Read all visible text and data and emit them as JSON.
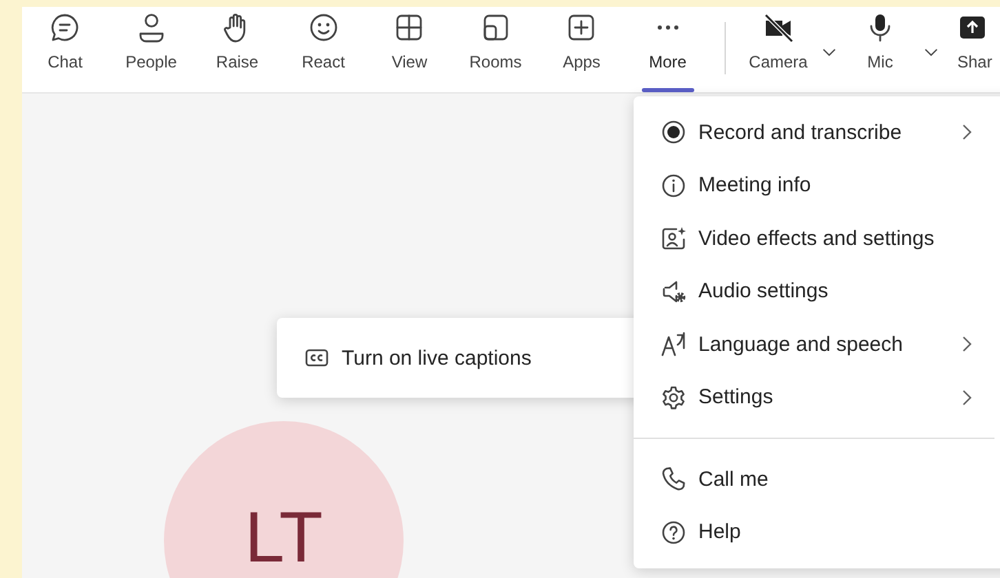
{
  "toolbar": {
    "buttons": [
      {
        "label": "Chat",
        "kind": "button",
        "selected": false
      },
      {
        "label": "People",
        "kind": "button",
        "selected": false
      },
      {
        "label": "Raise",
        "kind": "button",
        "selected": false
      },
      {
        "label": "React",
        "kind": "button",
        "selected": false
      },
      {
        "label": "View",
        "kind": "button",
        "selected": false
      },
      {
        "label": "Rooms",
        "kind": "button",
        "selected": false
      },
      {
        "label": "Apps",
        "kind": "button",
        "selected": false
      },
      {
        "label": "More",
        "kind": "button",
        "selected": true
      },
      {
        "label": "Camera",
        "kind": "split",
        "selected": false
      },
      {
        "label": "Mic",
        "kind": "split",
        "selected": false
      },
      {
        "label": "Shar",
        "kind": "button",
        "selected": false
      }
    ]
  },
  "stage": {
    "avatar": {
      "initials": "LT"
    }
  },
  "captions_menu": {
    "items": [
      {
        "label": "Turn on live captions",
        "submenu": false
      }
    ]
  },
  "more_menu": {
    "groups": [
      [
        {
          "label": "Record and transcribe",
          "submenu": true
        },
        {
          "label": "Meeting info",
          "submenu": false
        },
        {
          "label": "Video effects and settings",
          "submenu": false
        },
        {
          "label": "Audio settings",
          "submenu": false
        },
        {
          "label": "Language and speech",
          "submenu": true
        },
        {
          "label": "Settings",
          "submenu": true
        }
      ],
      [
        {
          "label": "Call me",
          "submenu": false
        },
        {
          "label": "Help",
          "submenu": false
        }
      ]
    ]
  }
}
